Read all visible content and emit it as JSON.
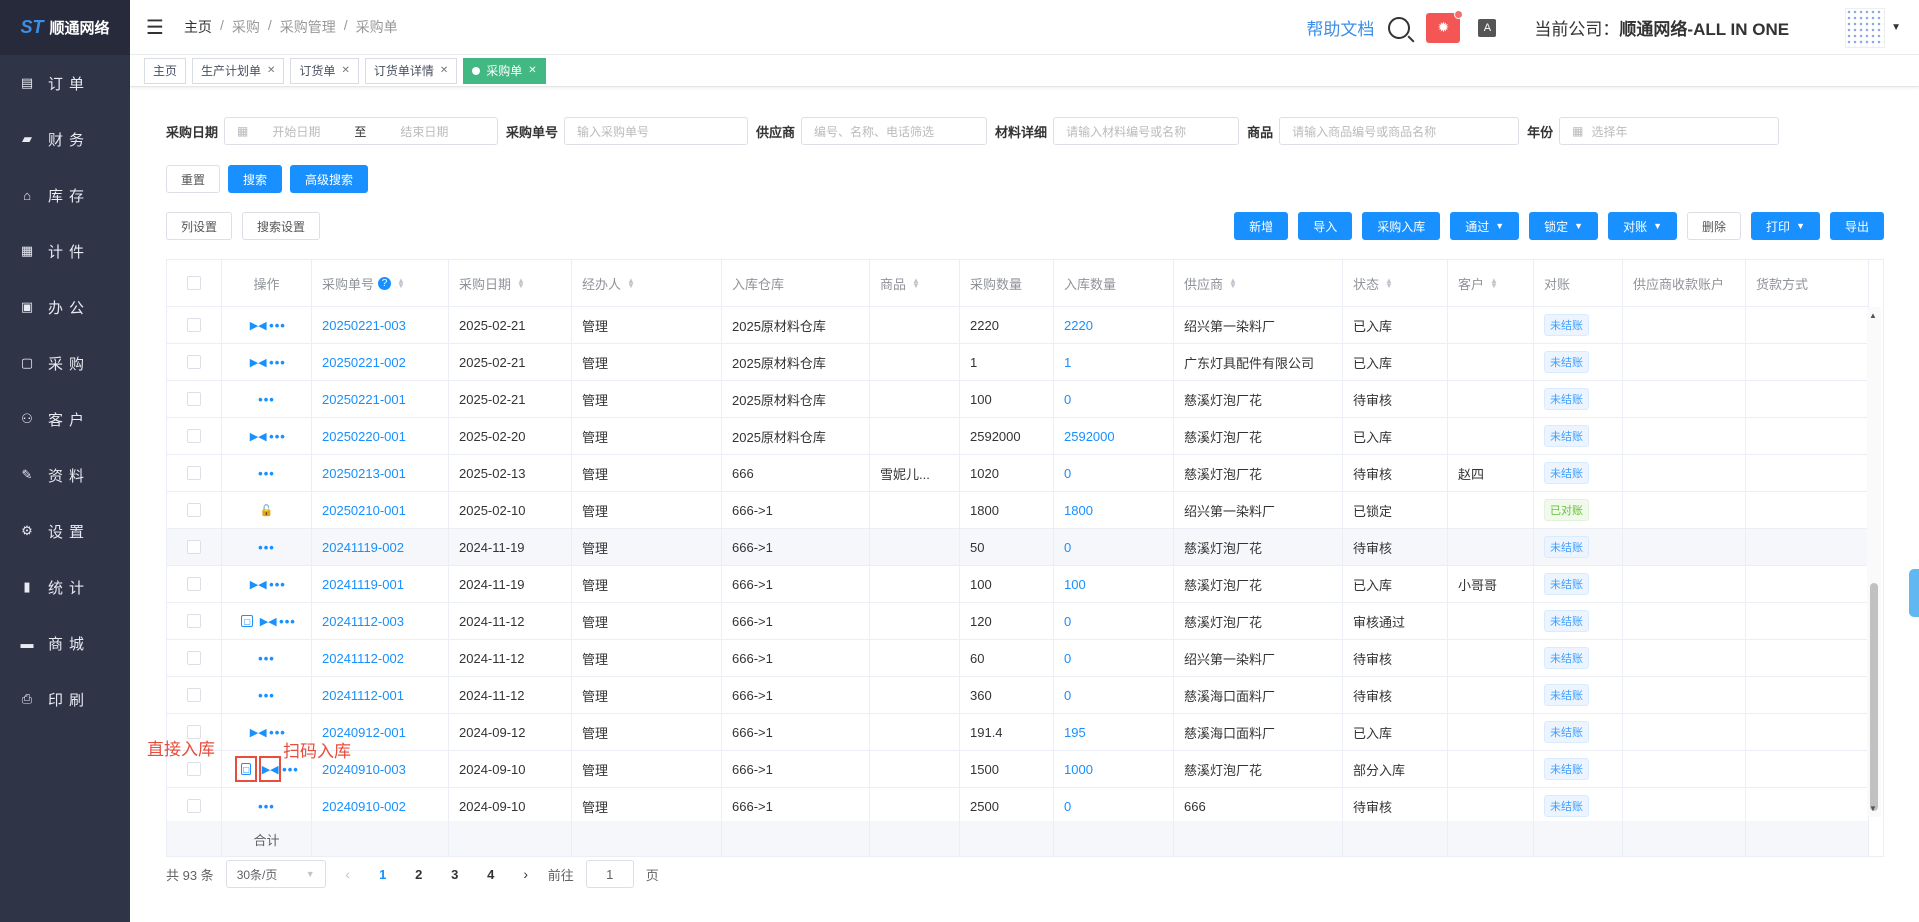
{
  "sidebar": {
    "logo_text": "顺通网络",
    "logo_mark": "ST",
    "items": [
      {
        "label": "订单",
        "icon": "order-icon",
        "glyph": "▤"
      },
      {
        "label": "财务",
        "icon": "finance-icon",
        "glyph": "▰"
      },
      {
        "label": "库存",
        "icon": "warehouse-icon",
        "glyph": "⌂"
      },
      {
        "label": "计件",
        "icon": "piecework-icon",
        "glyph": "▦"
      },
      {
        "label": "办公",
        "icon": "office-icon",
        "glyph": "▣"
      },
      {
        "label": "采购",
        "icon": "purchase-icon",
        "glyph": "▢"
      },
      {
        "label": "客户",
        "icon": "customer-icon",
        "glyph": "⚇"
      },
      {
        "label": "资料",
        "icon": "material-icon",
        "glyph": "✎"
      },
      {
        "label": "设置",
        "icon": "settings-icon",
        "glyph": "⚙"
      },
      {
        "label": "统计",
        "icon": "statistics-icon",
        "glyph": "▮"
      },
      {
        "label": "商城",
        "icon": "mall-icon",
        "glyph": "▬"
      },
      {
        "label": "印刷",
        "icon": "print-icon",
        "glyph": "⎙"
      }
    ]
  },
  "topbar": {
    "breadcrumb": [
      "主页",
      "采购",
      "采购管理",
      "采购单"
    ],
    "help_label": "帮助文档",
    "company_prefix": "当前公司：",
    "company_name": "顺通网络-ALL IN ONE",
    "bug_glyph": "✹",
    "font_glyph": "A"
  },
  "tabs": [
    {
      "label": "主页",
      "closable": false
    },
    {
      "label": "生产计划单",
      "closable": true
    },
    {
      "label": "订货单",
      "closable": true
    },
    {
      "label": "订货单详情",
      "closable": true
    },
    {
      "label": "采购单",
      "closable": true,
      "active": true
    }
  ],
  "filters": {
    "date_label": "采购日期",
    "date_start_placeholder": "开始日期",
    "date_sep": "至",
    "date_end_placeholder": "结束日期",
    "order_no_label": "采购单号",
    "order_no_placeholder": "输入采购单号",
    "supplier_label": "供应商",
    "supplier_placeholder": "编号、名称、电话筛选",
    "material_label": "材料详细",
    "material_placeholder": "请输入材料编号或名称",
    "product_label": "商品",
    "product_placeholder": "请输入商品编号或商品名称",
    "year_label": "年份",
    "year_placeholder": "选择年"
  },
  "buttons": {
    "reset": "重置",
    "search": "搜索",
    "advanced": "高级搜索",
    "columns": "列设置",
    "search_settings": "搜索设置",
    "new": "新增",
    "import": "导入",
    "purchase_in": "采购入库",
    "approve": "通过",
    "lock": "锁定",
    "reconcile": "对账",
    "delete": "删除",
    "print": "打印",
    "export": "导出"
  },
  "table": {
    "headers": {
      "op": "操作",
      "order_no": "采购单号",
      "date": "采购日期",
      "handler": "经办人",
      "warehouse": "入库仓库",
      "product": "商品",
      "qty": "采购数量",
      "in_qty": "入库数量",
      "supplier": "供应商",
      "status": "状态",
      "customer": "客户",
      "recon": "对账",
      "account": "供应商收款账户",
      "payment": "货款方式"
    },
    "rows": [
      {
        "ops": "scan",
        "order_no": "20250221-003",
        "date": "2025-02-21",
        "handler": "管理",
        "warehouse": "2025原材料仓库",
        "product": "",
        "qty": "2220",
        "in_qty": "2220",
        "supplier": "绍兴第一染料厂",
        "status": "已入库",
        "customer": "",
        "recon": "未结账"
      },
      {
        "ops": "scan",
        "order_no": "20250221-002",
        "date": "2025-02-21",
        "handler": "管理",
        "warehouse": "2025原材料仓库",
        "product": "",
        "qty": "1",
        "in_qty": "1",
        "supplier": "广东灯具配件有限公司",
        "status": "已入库",
        "customer": "",
        "recon": "未结账"
      },
      {
        "ops": "none",
        "order_no": "20250221-001",
        "date": "2025-02-21",
        "handler": "管理",
        "warehouse": "2025原材料仓库",
        "product": "",
        "qty": "100",
        "in_qty": "0",
        "supplier": "慈溪灯泡厂花",
        "status": "待审核",
        "customer": "",
        "recon": "未结账"
      },
      {
        "ops": "scan",
        "order_no": "20250220-001",
        "date": "2025-02-20",
        "handler": "管理",
        "warehouse": "2025原材料仓库",
        "product": "",
        "qty": "2592000",
        "in_qty": "2592000",
        "supplier": "慈溪灯泡厂花",
        "status": "已入库",
        "customer": "",
        "recon": "未结账"
      },
      {
        "ops": "none",
        "order_no": "20250213-001",
        "date": "2025-02-13",
        "handler": "管理",
        "warehouse": "666",
        "product": "雪妮儿...",
        "qty": "1020",
        "in_qty": "0",
        "supplier": "慈溪灯泡厂花",
        "status": "待审核",
        "customer": "赵四",
        "recon": "未结账"
      },
      {
        "ops": "lock",
        "order_no": "20250210-001",
        "date": "2025-02-10",
        "handler": "管理",
        "warehouse": "666->1",
        "product": "",
        "qty": "1800",
        "in_qty": "1800",
        "supplier": "绍兴第一染料厂",
        "status": "已锁定",
        "customer": "",
        "recon": "已对账"
      },
      {
        "ops": "none",
        "order_no": "20241119-002",
        "date": "2024-11-19",
        "handler": "管理",
        "warehouse": "666->1",
        "product": "",
        "qty": "50",
        "in_qty": "0",
        "supplier": "慈溪灯泡厂花",
        "status": "待审核",
        "customer": "",
        "recon": "未结账"
      },
      {
        "ops": "scan",
        "order_no": "20241119-001",
        "date": "2024-11-19",
        "handler": "管理",
        "warehouse": "666->1",
        "product": "",
        "qty": "100",
        "in_qty": "100",
        "supplier": "慈溪灯泡厂花",
        "status": "已入库",
        "customer": "小哥哥",
        "recon": "未结账"
      },
      {
        "ops": "direct-scan",
        "order_no": "20241112-003",
        "date": "2024-11-12",
        "handler": "管理",
        "warehouse": "666->1",
        "product": "",
        "qty": "120",
        "in_qty": "0",
        "supplier": "慈溪灯泡厂花",
        "status": "审核通过",
        "customer": "",
        "recon": "未结账"
      },
      {
        "ops": "none",
        "order_no": "20241112-002",
        "date": "2024-11-12",
        "handler": "管理",
        "warehouse": "666->1",
        "product": "",
        "qty": "60",
        "in_qty": "0",
        "supplier": "绍兴第一染料厂",
        "status": "待审核",
        "customer": "",
        "recon": "未结账"
      },
      {
        "ops": "none",
        "order_no": "20241112-001",
        "date": "2024-11-12",
        "handler": "管理",
        "warehouse": "666->1",
        "product": "",
        "qty": "360",
        "in_qty": "0",
        "supplier": "慈溪海口面料厂",
        "status": "待审核",
        "customer": "",
        "recon": "未结账"
      },
      {
        "ops": "scan",
        "order_no": "20240912-001",
        "date": "2024-09-12",
        "handler": "管理",
        "warehouse": "666->1",
        "product": "",
        "qty": "191.4",
        "in_qty": "195",
        "supplier": "慈溪海口面料厂",
        "status": "已入库",
        "customer": "",
        "recon": "未结账"
      },
      {
        "ops": "annotated",
        "order_no": "20240910-003",
        "date": "2024-09-10",
        "handler": "管理",
        "warehouse": "666->1",
        "product": "",
        "qty": "1500",
        "in_qty": "1000",
        "supplier": "慈溪灯泡厂花",
        "status": "部分入库",
        "customer": "",
        "recon": "未结账"
      },
      {
        "ops": "none",
        "order_no": "20240910-002",
        "date": "2024-09-10",
        "handler": "管理",
        "warehouse": "666->1",
        "product": "",
        "qty": "2500",
        "in_qty": "0",
        "supplier": "666",
        "status": "待审核",
        "customer": "",
        "recon": "未结账"
      }
    ],
    "footer_label": "合计"
  },
  "annotations": {
    "direct_in": "直接入库",
    "scan_in": "扫码入库"
  },
  "pager": {
    "total": "共 93 条",
    "page_size": "30条/页",
    "pages": [
      "1",
      "2",
      "3",
      "4"
    ],
    "current": "1",
    "goto_label": "前往",
    "goto_value": "1",
    "page_unit": "页"
  },
  "colors": {
    "primary": "#1890ff",
    "sidebar": "#2f3447",
    "active_tab": "#42b983",
    "annotation": "#e74c3c"
  }
}
